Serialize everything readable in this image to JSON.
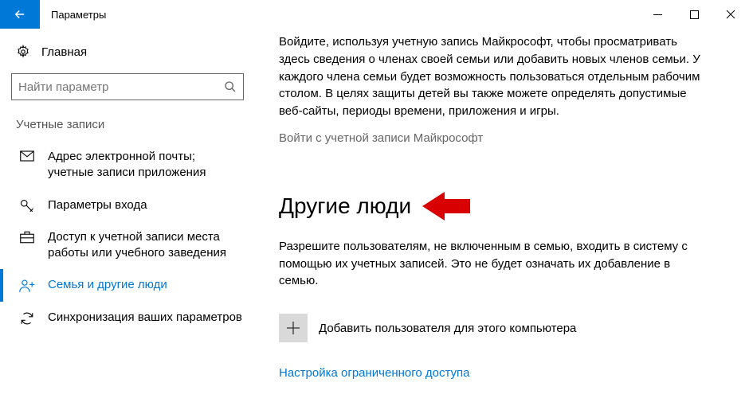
{
  "titlebar": {
    "title": "Параметры"
  },
  "sidebar": {
    "home": "Главная",
    "search_placeholder": "Найти параметр",
    "section_label": "Учетные записи",
    "items": [
      {
        "label": "Адрес электронной почты; учетные записи приложения"
      },
      {
        "label": "Параметры входа"
      },
      {
        "label": "Доступ к учетной записи места работы или учебного заведения"
      },
      {
        "label": "Семья и другие люди"
      },
      {
        "label": "Синхронизация ваших параметров"
      }
    ]
  },
  "content": {
    "intro": "Войдите, используя учетную запись Майкрософт, чтобы просматривать здесь сведения о членах своей семьи или добавить новых членов семьи. У каждого члена семьи будет возможность пользоваться отдельным рабочим столом. В целях защиты детей вы также можете определять допустимые веб-сайты, периоды времени, приложения и игры.",
    "signin_link": "Войти с учетной записи Майкрософт",
    "section_heading": "Другие люди",
    "section_body": "Разрешите пользователям, не включенным в семью, входить в систему с помощью их учетных записей. Это не будет означать их добавление в семью.",
    "add_user": "Добавить пользователя для этого компьютера",
    "restricted_link": "Настройка ограниченного доступа"
  }
}
